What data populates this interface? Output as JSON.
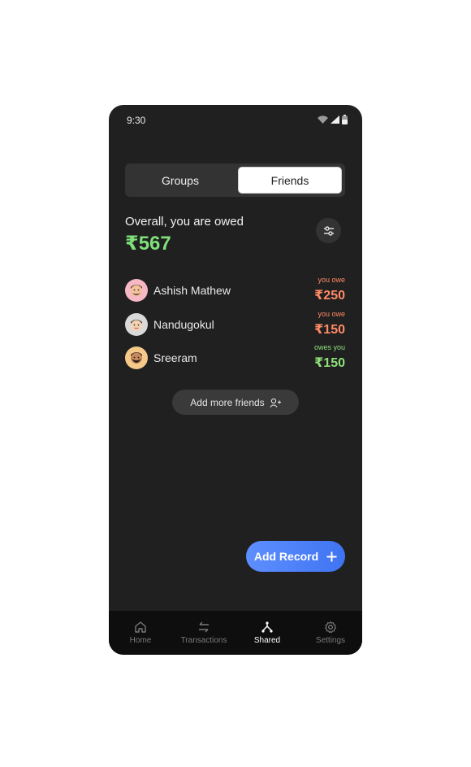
{
  "status_bar": {
    "time": "9:30"
  },
  "segment": {
    "groups_label": "Groups",
    "friends_label": "Friends",
    "selected": "Friends"
  },
  "summary": {
    "label": "Overall, you are owed",
    "amount": "₹567",
    "amount_color": "#7fe07a"
  },
  "friends": [
    {
      "name": "Ashish Mathew",
      "status": "you owe",
      "amount": "₹250",
      "avatar_bg": "#f5b8c4"
    },
    {
      "name": "Nandugokul",
      "status": "you owe",
      "amount": "₹150",
      "avatar_bg": "#d9d9d9"
    },
    {
      "name": "Sreeram",
      "status": "owes you",
      "amount": "₹150",
      "avatar_bg": "#f4c98a"
    }
  ],
  "add_friends": {
    "label": "Add more friends",
    "icon": "add-user-icon"
  },
  "add_record": {
    "label": "Add Record",
    "icon": "plus-icon"
  },
  "nav": [
    {
      "label": "Home",
      "icon": "home-icon"
    },
    {
      "label": "Transactions",
      "icon": "transfer-icon"
    },
    {
      "label": "Shared",
      "icon": "share-icon",
      "active": true
    },
    {
      "label": "Settings",
      "icon": "gear-icon"
    }
  ],
  "colors": {
    "owe": "#ff8a66",
    "owed": "#8fe07a",
    "accent": "#4f7ff6"
  }
}
